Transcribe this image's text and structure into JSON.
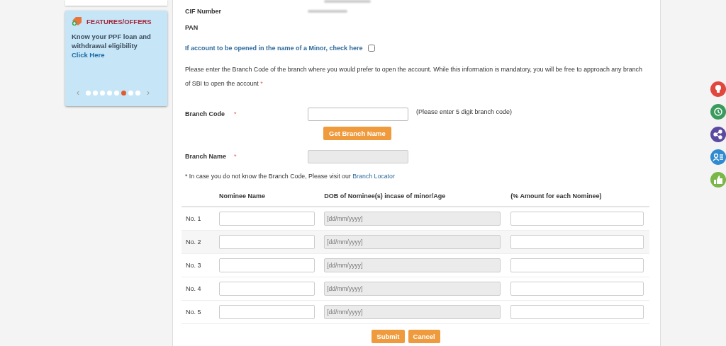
{
  "sidebar": {
    "offers": {
      "title": "FEATURES/OFFERS",
      "text": "Know your PPF loan and withdrawal eligibility",
      "link": "Click Here",
      "prev": "‹",
      "next": "›",
      "dots": [
        {
          "selected": false
        },
        {
          "selected": false
        },
        {
          "selected": false
        },
        {
          "selected": false
        },
        {
          "selected": false
        },
        {
          "selected": true
        },
        {
          "selected": false
        },
        {
          "selected": false
        }
      ]
    }
  },
  "form": {
    "fields": [
      {
        "label": "CIF Number",
        "kind": "masked"
      },
      {
        "label": "PAN",
        "kind": "empty"
      }
    ],
    "minor": {
      "label": "If account to be opened in the name of a Minor, check here",
      "checked": false
    },
    "instruction": "Please enter the Branch Code of the branch where you would prefer to open the account. While this information is mandatory, you will be free to approach any branch of SBI to open the account",
    "required_mark": "*",
    "branch_code": {
      "label": "Branch Code",
      "required": "*",
      "hint": "(Please enter 5 digit branch code)",
      "button": "Get Branch Name"
    },
    "branch_name": {
      "label": "Branch Name",
      "required": "*"
    },
    "note": "* In case you do not know the Branch Code, Please visit our",
    "note_link": "Branch Locator",
    "table": {
      "columns": [
        "Nominee Name",
        "DOB of Nominee(s) incase of minor/Age",
        "(% Amount for each Nominee)"
      ],
      "rows": [
        {
          "label": "No. 1",
          "dob_placeholder": "[dd/mm/yyyy]"
        },
        {
          "label": "No. 2",
          "dob_placeholder": "[dd/mm/yyyy]"
        },
        {
          "label": "No. 3",
          "dob_placeholder": "[dd/mm/yyyy]"
        },
        {
          "label": "No. 4",
          "dob_placeholder": "[dd/mm/yyyy]"
        },
        {
          "label": "No. 5",
          "dob_placeholder": "[dd/mm/yyyy]"
        }
      ]
    },
    "buttons": [
      "Submit",
      "Cancel"
    ]
  },
  "floating": [
    {
      "kind": "bulb",
      "color": "#e0483e"
    },
    {
      "kind": "clock",
      "color": "#3b9a5e"
    },
    {
      "kind": "share",
      "color": "#5b4aa0"
    },
    {
      "kind": "list",
      "color": "#2f8ad0"
    },
    {
      "kind": "thumb",
      "color": "#7ab648"
    }
  ]
}
